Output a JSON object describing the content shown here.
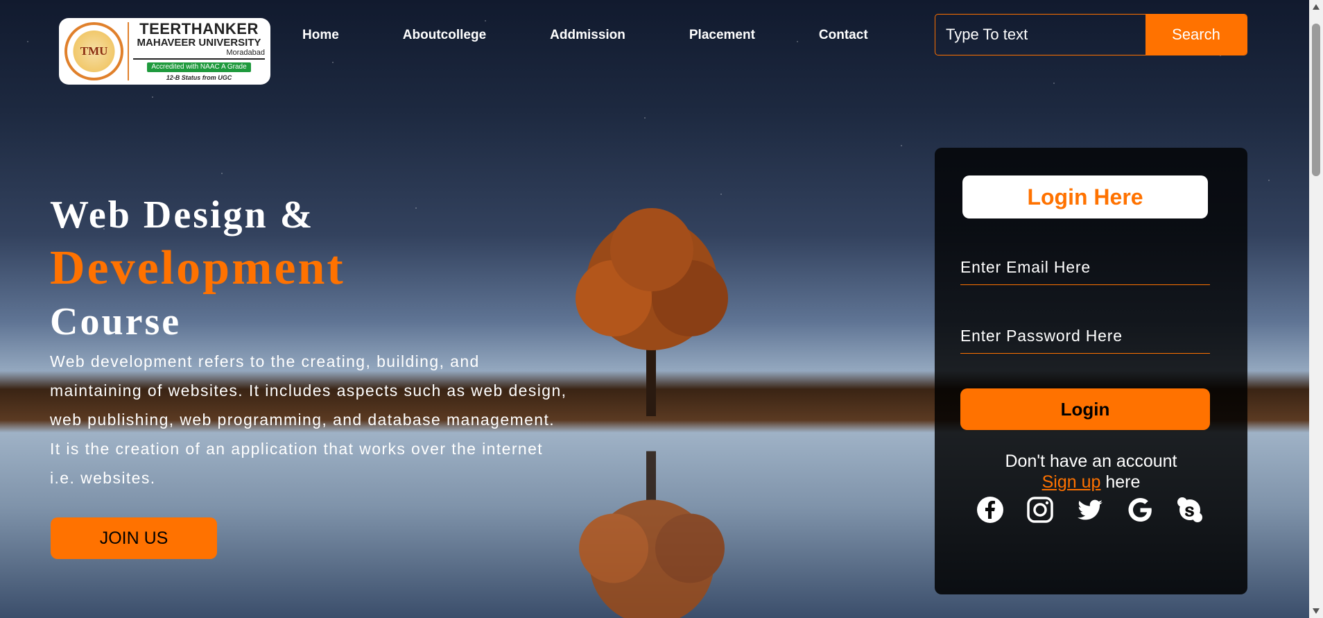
{
  "logo": {
    "seal_text": "TMU",
    "title_line1": "TEERTHANKER",
    "title_line2": "MAHAVEER UNIVERSITY",
    "city": "Moradabad",
    "badge": "Accredited with NAAC A Grade",
    "status": "12-B Status from UGC"
  },
  "nav": {
    "items": [
      "Home",
      "Aboutcollege",
      "Addmission",
      "Placement",
      "Contact"
    ]
  },
  "search": {
    "placeholder": "Type To text",
    "button_label": "Search"
  },
  "hero": {
    "line1": "Web Design &",
    "line2": "Development",
    "line3": "Course",
    "description": "Web development refers to the creating, building, and maintaining of websites. It includes aspects such as web design, web publishing, web programming, and database management. It is the creation of an application that works over the internet i.e. websites.",
    "join_label": "JOIN US"
  },
  "login": {
    "heading": "Login Here",
    "email_placeholder": "Enter Email Here",
    "password_placeholder": "Enter Password Here",
    "button_label": "Login",
    "no_account_text": "Don't have an account",
    "signup_link": "Sign up",
    "signup_suffix": " here"
  },
  "social_icons": [
    "facebook-icon",
    "instagram-icon",
    "twitter-icon",
    "google-icon",
    "skype-icon"
  ],
  "colors": {
    "accent": "#ff7200",
    "card_bg": "#0b0b0b",
    "text": "#ffffff"
  }
}
